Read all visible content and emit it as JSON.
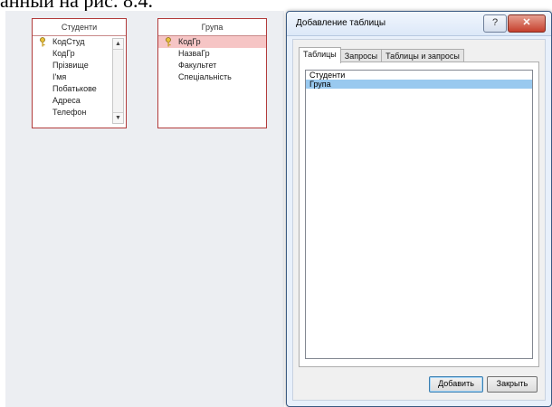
{
  "document": {
    "text": "анный на рис. 8.4."
  },
  "tables": [
    {
      "title": "Студенти",
      "fields": [
        "КодСтуд",
        "КодГр",
        "Прізвище",
        "І'мя",
        "Побатькове",
        "Адреса",
        "Телефон"
      ],
      "key_field": 0
    },
    {
      "title": "Група",
      "fields": [
        "КодГр",
        "НазваГр",
        "Факультет",
        "Спеціальність"
      ],
      "key_field": 0,
      "selected_field": 0
    }
  ],
  "dialog": {
    "title": "Добавление таблицы",
    "help_label": "?",
    "close_label": "✕",
    "tabs": [
      "Таблицы",
      "Запросы",
      "Таблицы и запросы"
    ],
    "active_tab": 0,
    "list_items": [
      "Студенти",
      "Група"
    ],
    "selected_item": 1,
    "add_button": "Добавить",
    "close_button": "Закрыть"
  },
  "colors": {
    "table_border": "#b23b3b",
    "selected_field": "#f6c5c5",
    "list_selection": "#99c9ef",
    "workspace": "#eceef2"
  }
}
